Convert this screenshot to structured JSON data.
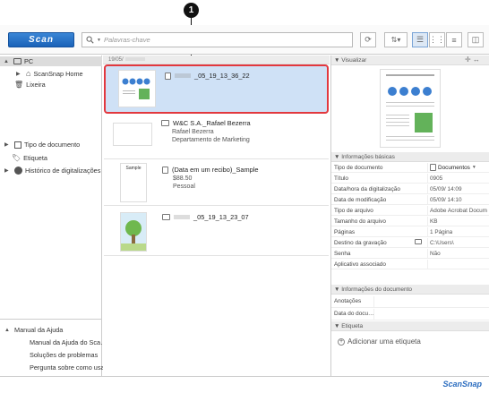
{
  "toolbar": {
    "scan_label": "Scan",
    "search_placeholder": "Palavras-chave"
  },
  "callout": {
    "number": "1"
  },
  "sidebar": {
    "pc_label": "PC",
    "items": [
      "ScanSnap Home",
      "Lixeira"
    ],
    "groups": [
      "Tipo de documento",
      "Etiqueta",
      "Histórico de digitalizações"
    ],
    "help_header": "Manual da Ajuda",
    "help_items": [
      "Manual da Ajuda do Sca…",
      "Soluções de problemas",
      "Pergunta sobre como usar"
    ]
  },
  "list": {
    "date_header": "19/05/",
    "cards": [
      {
        "name": "_05_19_13_36_22",
        "lines": []
      },
      {
        "name": "W&C S.A._Rafael Bezerra",
        "lines": [
          "Rafael Bezerra",
          "Departamento de Marketing"
        ]
      },
      {
        "name": "(Data em um recibo)_Sample",
        "lines": [
          "$88.50",
          "Pessoal"
        ]
      },
      {
        "name": "_05_19_13_23_07",
        "lines": []
      }
    ]
  },
  "preview": {
    "header": "Visualizar"
  },
  "basic_info": {
    "header": "Informações básicas",
    "rows": [
      {
        "k": "Tipo de documento",
        "v": "Documentos"
      },
      {
        "k": "Título",
        "v": "0905"
      },
      {
        "k": "Data/hora da digitalização",
        "v": "05/09/ 14:09"
      },
      {
        "k": "Data de modificação",
        "v": "05/09/ 14:10"
      },
      {
        "k": "Tipo de arquivo",
        "v": "Adobe Acrobat Docum"
      },
      {
        "k": "Tamanho do arquivo",
        "v": "KB"
      },
      {
        "k": "Páginas",
        "v": "1 Página"
      },
      {
        "k": "Destino da gravação",
        "v": "C:\\Users\\"
      },
      {
        "k": "Senha",
        "v": "Não"
      },
      {
        "k": "Aplicativo associado",
        "v": ""
      }
    ]
  },
  "doc_info": {
    "header": "Informações do documento",
    "rows": [
      {
        "k": "Anotações",
        "v": ""
      },
      {
        "k": "Data do docu…",
        "v": ""
      }
    ]
  },
  "tags": {
    "header": "Etiqueta",
    "add_label": "Adicionar uma etiqueta"
  },
  "footer": {
    "logo": "ScanSnap"
  }
}
